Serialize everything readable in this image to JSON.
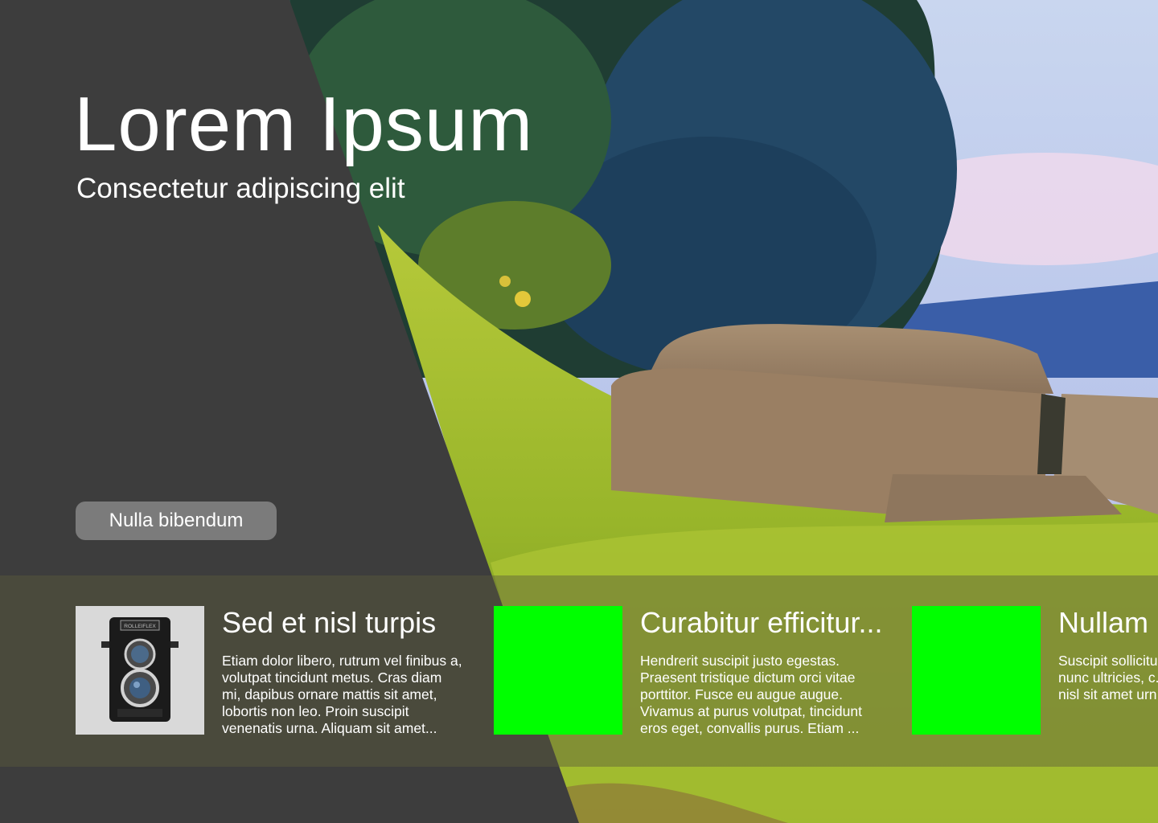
{
  "hero": {
    "title": "Lorem Ipsum",
    "subtitle": "Consectetur adipiscing elit",
    "cta_label": "Nulla bibendum"
  },
  "cards": [
    {
      "title": "Sed et nisl turpis",
      "body": "Etiam dolor libero, rutrum vel finibus a, volutpat tincidunt metus. Cras diam mi, dapibus ornare mattis sit amet, lobortis non leo. Proin suscipit venenatis urna. Aliquam sit amet...",
      "thumb": "camera-photo",
      "thumb_brand": "ROLLEIFLEX"
    },
    {
      "title": "Curabitur efficitur...",
      "body": "Hendrerit suscipit justo egestas. Praesent tristique dictum orci vitae porttitor. Fusce eu augue augue. Vivamus at purus volutpat, tincidunt eros eget, convallis purus. Etiam ...",
      "thumb": "green-placeholder"
    },
    {
      "title": "Nullam",
      "body": "Suscipit sollicitu... posuere dictum... nunc ultricies, c... ullamcorper vel... nisl sit amet urn...",
      "thumb": "green-placeholder"
    }
  ],
  "colors": {
    "panel": "#3d3d3d",
    "button": "#7b7b7b",
    "placeholder": "#00ff00",
    "text": "#ffffff"
  }
}
